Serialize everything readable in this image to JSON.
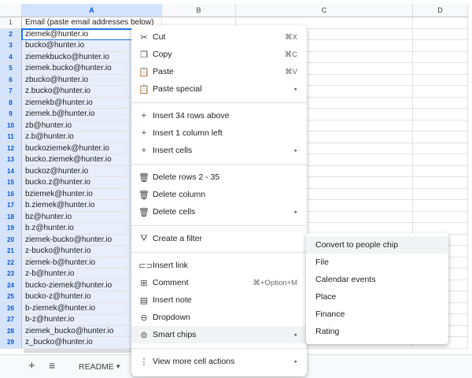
{
  "columns": [
    "A",
    "B",
    "C",
    "D"
  ],
  "rows": [
    {
      "n": "1",
      "v": "Email (paste email addresses below)"
    },
    {
      "n": "2",
      "v": "ziemek@hunter.io"
    },
    {
      "n": "3",
      "v": "bucko@hunter.io"
    },
    {
      "n": "4",
      "v": "ziemekbucko@hunter.io"
    },
    {
      "n": "5",
      "v": "ziemek.bucko@hunter.io"
    },
    {
      "n": "6",
      "v": "zbucko@hunter.io"
    },
    {
      "n": "7",
      "v": "z.bucko@hunter.io"
    },
    {
      "n": "8",
      "v": "ziemekb@hunter.io"
    },
    {
      "n": "9",
      "v": "ziemek.b@hunter.io"
    },
    {
      "n": "10",
      "v": "zb@hunter.io"
    },
    {
      "n": "11",
      "v": "z.b@hunter.io"
    },
    {
      "n": "12",
      "v": "buckoziemek@hunter.io"
    },
    {
      "n": "13",
      "v": "bucko.ziemek@hunter.io"
    },
    {
      "n": "14",
      "v": "buckoz@hunter.io"
    },
    {
      "n": "15",
      "v": "bucko.z@hunter.io"
    },
    {
      "n": "16",
      "v": "bziemek@hunter.io"
    },
    {
      "n": "17",
      "v": "b.ziemek@hunter.io"
    },
    {
      "n": "18",
      "v": "bz@hunter.io"
    },
    {
      "n": "19",
      "v": "b.z@hunter.io"
    },
    {
      "n": "20",
      "v": "ziemek-bucko@hunter.io"
    },
    {
      "n": "21",
      "v": "z-bucko@hunter.io"
    },
    {
      "n": "22",
      "v": "ziemek-b@hunter.io"
    },
    {
      "n": "23",
      "v": "z-b@hunter.io"
    },
    {
      "n": "24",
      "v": "bucko-ziemek@hunter.io"
    },
    {
      "n": "25",
      "v": "bucko-z@hunter.io"
    },
    {
      "n": "26",
      "v": "b-ziemek@hunter.io"
    },
    {
      "n": "27",
      "v": "b-z@hunter.io"
    },
    {
      "n": "28",
      "v": "ziemek_bucko@hunter.io"
    },
    {
      "n": "29",
      "v": "z_bucko@hunter.io"
    }
  ],
  "bottom": {
    "add": "+",
    "sheets_menu": "≡",
    "sheet_tab": "README",
    "sheet_arrow": "▾"
  },
  "menu": [
    {
      "label": "Cut",
      "icon": "✂",
      "icon_name": "scissors",
      "shortcut": "⌘X"
    },
    {
      "label": "Copy",
      "icon": "❐",
      "icon_name": "copy",
      "shortcut": "⌘C"
    },
    {
      "label": "Paste",
      "icon": "📋",
      "icon_name": "clipboard",
      "shortcut": "⌘V"
    },
    {
      "label": "Paste special",
      "icon": "📋",
      "icon_name": "clipboard",
      "arrow": "▸"
    },
    {
      "divider": true
    },
    {
      "label": "Insert 34 rows above",
      "icon": "+",
      "icon_name": "plus"
    },
    {
      "label": "Insert 1 column left",
      "icon": "+",
      "icon_name": "plus"
    },
    {
      "label": "Insert cells",
      "icon": "+",
      "icon_name": "plus",
      "arrow": "▸"
    },
    {
      "divider": true
    },
    {
      "label": "Delete rows 2 - 35",
      "icon": "🗑",
      "icon_name": "trash"
    },
    {
      "label": "Delete column",
      "icon": "🗑",
      "icon_name": "trash"
    },
    {
      "label": "Delete cells",
      "icon": "🗑",
      "icon_name": "trash",
      "arrow": "▸"
    },
    {
      "divider": true
    },
    {
      "label": "Create a filter",
      "icon": "⛛",
      "icon_name": "filter"
    },
    {
      "divider": true
    },
    {
      "label": "Insert link",
      "icon": "⊂⊃",
      "icon_name": "link"
    },
    {
      "label": "Comment",
      "icon": "⊞",
      "icon_name": "comment",
      "shortcut": "⌘+Option+M"
    },
    {
      "label": "Insert note",
      "icon": "▤",
      "icon_name": "note"
    },
    {
      "label": "Dropdown",
      "icon": "⊖",
      "icon_name": "dropdown"
    },
    {
      "label": "Smart chips",
      "icon": "⊜",
      "icon_name": "smart-chips",
      "arrow": "▸",
      "highlight": true
    },
    {
      "divider": true
    },
    {
      "label": "View more cell actions",
      "icon": "⋮",
      "icon_name": "more-vert",
      "arrow": "▸"
    }
  ],
  "submenu": [
    "Convert to people chip",
    "File",
    "Calendar events",
    "Place",
    "Finance",
    "Rating"
  ],
  "colors": {
    "selection": "#d3e3fd",
    "accent": "#1a73e8"
  }
}
